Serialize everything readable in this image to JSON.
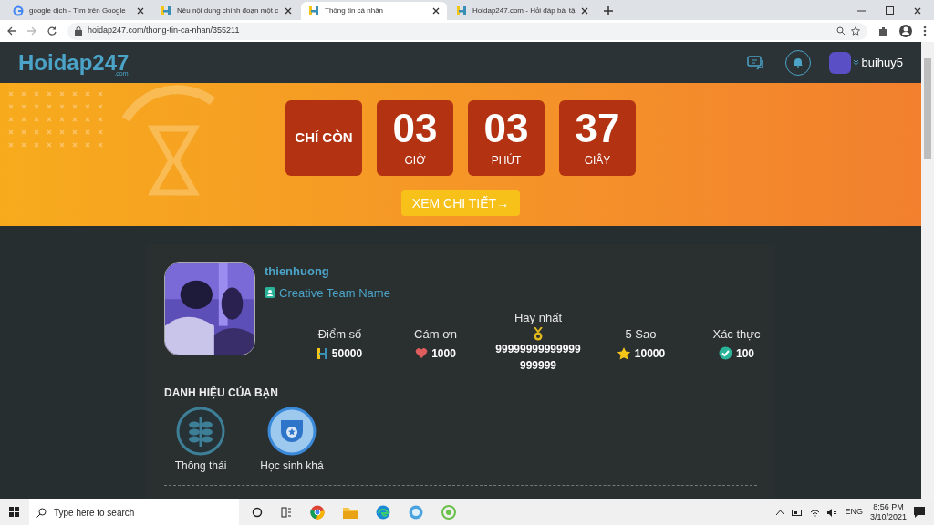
{
  "browser": {
    "tabs": [
      {
        "title": "google dịch - Tìm trên Google",
        "selected": false
      },
      {
        "title": "Nêu nội dung chính đoạn một c",
        "selected": false
      },
      {
        "title": "Thông tin cá nhân",
        "selected": true
      },
      {
        "title": "Hoidap247.com - Hỏi đáp bài tậ",
        "selected": false
      }
    ],
    "url": "hoidap247.com/thong-tin-ca-nhan/355211"
  },
  "header": {
    "logo": "Hoidap247",
    "logo_sub": ".com",
    "username": "buihuy5"
  },
  "banner": {
    "countdown": [
      {
        "kind": "label",
        "value": "CHÍ CÒN"
      },
      {
        "kind": "unit",
        "value": "03",
        "unit": "GIỜ"
      },
      {
        "kind": "unit",
        "value": "03",
        "unit": "PHÚT"
      },
      {
        "kind": "unit",
        "value": "37",
        "unit": "GIÂY"
      }
    ],
    "button": "XEM CHI TIẾT→"
  },
  "profile": {
    "name": "thienhuong",
    "team": "Creative Team Name",
    "stats": [
      {
        "kind": "points",
        "label": "Điểm số",
        "value": "50000"
      },
      {
        "kind": "thanks",
        "label": "Cám ơn",
        "value": "1000"
      },
      {
        "kind": "best",
        "label": "Hay nhất",
        "value": "99999999999999999999"
      },
      {
        "kind": "stars",
        "label": "5 Sao",
        "value": "10000"
      },
      {
        "kind": "verified",
        "label": "Xác thực",
        "value": "100"
      }
    ],
    "titles_heading": "DANH HIỆU CỦA BẠN",
    "titles": [
      {
        "kind": "wheat",
        "label": "Thông thái"
      },
      {
        "kind": "shield",
        "label": "Học sinh khá"
      }
    ]
  },
  "taskbar": {
    "search_placeholder": "Type here to search",
    "language": "ENG",
    "time": "8:56 PM",
    "date": "3/10/2021"
  }
}
